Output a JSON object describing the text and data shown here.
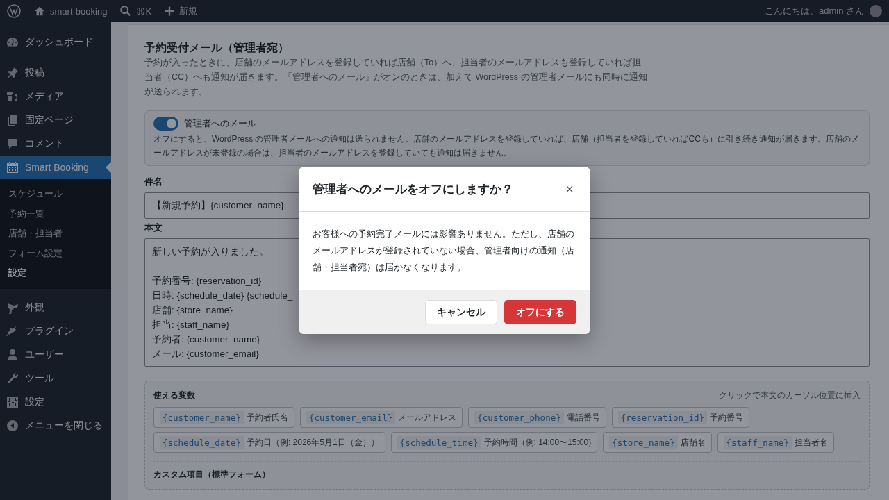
{
  "admin_bar": {
    "site": "smart-booking",
    "search_shortcut": "⌘K",
    "new": "新規",
    "greeting": "こんにちは、admin さん"
  },
  "sidebar": {
    "items": [
      {
        "label": "ダッシュボード",
        "selected": false
      },
      {
        "label": "投稿",
        "selected": false
      },
      {
        "label": "メディア",
        "selected": false
      },
      {
        "label": "固定ページ",
        "selected": false
      },
      {
        "label": "コメント",
        "selected": false
      },
      {
        "label": "Smart Booking",
        "selected": true,
        "children": [
          {
            "label": "スケジュール",
            "selected": false
          },
          {
            "label": "予約一覧",
            "selected": false
          },
          {
            "label": "店舗・担当者",
            "selected": false
          },
          {
            "label": "フォーム設定",
            "selected": false
          },
          {
            "label": "設定",
            "selected": true
          }
        ]
      },
      {
        "label": "外観",
        "selected": false
      },
      {
        "label": "プラグイン",
        "selected": false
      },
      {
        "label": "ユーザー",
        "selected": false
      },
      {
        "label": "ツール",
        "selected": false
      },
      {
        "label": "設定",
        "selected": false
      },
      {
        "label": "メニューを閉じる",
        "selected": false
      }
    ]
  },
  "section": {
    "title": "予約受付メール（管理者宛）",
    "description": "予約が入ったときに、店舗のメールアドレスを登録していれば店舗（To）へ、担当者のメールアドレスも登録していれば担当者（CC）へも通知が届きます。「管理者へのメール」がオンのときは、加えて WordPress の管理者メールにも同時に通知が送られます。"
  },
  "admin_toggle": {
    "label": "管理者へのメール",
    "on": true,
    "help": "オフにすると、WordPress の管理者メールへの通知は送られません。店舗のメールアドレスを登録していれば、店舗（担当者を登録していればCCも）に引き続き通知が届きます。店舗のメールアドレスが未登録の場合は、担当者のメールアドレスを登録していても通知は届きません。"
  },
  "subject": {
    "label": "件名",
    "value": "【新規予約】{customer_name}"
  },
  "body": {
    "label": "本文",
    "paragraphs": [
      [
        "新しい予約が入りました。"
      ],
      [
        "予約番号: {reservation_id}",
        "日時: {schedule_date} {schedule_",
        "店舗: {store_name}",
        "担当: {staff_name}",
        "予約者: {customer_name}",
        "メール: {customer_email}"
      ]
    ]
  },
  "variables": {
    "title": "使える変数",
    "hint": "クリックで本文のカーソル位置に挿入",
    "items": [
      {
        "code": "{customer_name}",
        "label": "予約者氏名"
      },
      {
        "code": "{customer_email}",
        "label": "メールアドレス"
      },
      {
        "code": "{customer_phone}",
        "label": "電話番号"
      },
      {
        "code": "{reservation_id}",
        "label": "予約番号"
      },
      {
        "code": "{schedule_date}",
        "label": "予約日（例: 2026年5月1日（金））"
      },
      {
        "code": "{schedule_time}",
        "label": "予約時間（例: 14:00〜15:00)"
      },
      {
        "code": "{store_name}",
        "label": "店舗名"
      },
      {
        "code": "{staff_name}",
        "label": "担当者名"
      }
    ],
    "custom_title": "カスタム項目（標準フォーム）"
  },
  "dialog": {
    "title": "管理者へのメールをオフにしますか？",
    "close": "×",
    "message": "お客様への予約完了メールには影響ありません。ただし、店舗のメールアドレスが登録されていない場合、管理者向けの通知（店舗・担当者宛）は届かなくなります。",
    "cancel": "キャンセル",
    "confirm": "オフにする"
  }
}
